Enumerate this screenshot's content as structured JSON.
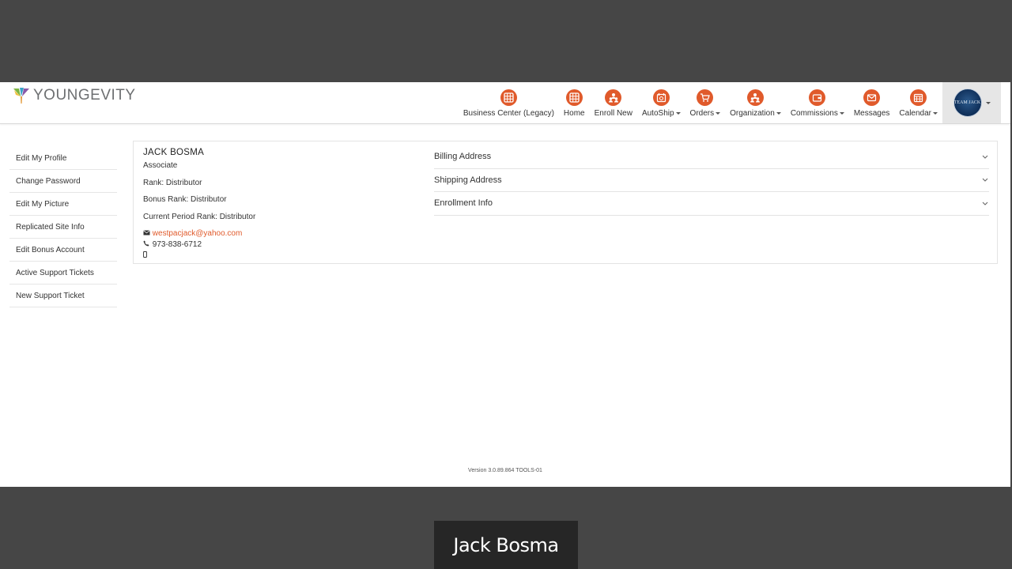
{
  "brand": {
    "name": "YOUNGEVITY",
    "accent": "#e05a2b"
  },
  "nav": [
    {
      "key": "business-center",
      "label": "Business Center (Legacy)",
      "icon": "grid-icon",
      "dropdown": false
    },
    {
      "key": "home",
      "label": "Home",
      "icon": "grid-icon",
      "dropdown": false
    },
    {
      "key": "enroll-new",
      "label": "Enroll New",
      "icon": "people-icon",
      "dropdown": false
    },
    {
      "key": "autoship",
      "label": "AutoShip",
      "icon": "autoship-icon",
      "dropdown": true
    },
    {
      "key": "orders",
      "label": "Orders",
      "icon": "cart-icon",
      "dropdown": true
    },
    {
      "key": "organization",
      "label": "Organization",
      "icon": "org-icon",
      "dropdown": true
    },
    {
      "key": "commissions",
      "label": "Commissions",
      "icon": "wallet-icon",
      "dropdown": true
    },
    {
      "key": "messages",
      "label": "Messages",
      "icon": "envelope-icon",
      "dropdown": false
    },
    {
      "key": "calendar",
      "label": "Calendar",
      "icon": "calendar-icon",
      "dropdown": true
    }
  ],
  "profile_avatar_text": "TEAM JACK",
  "sidebar": {
    "items": [
      "Edit My Profile",
      "Change Password",
      "Edit My Picture",
      "Replicated Site Info",
      "Edit Bonus Account",
      "Active Support Tickets",
      "New Support Ticket"
    ]
  },
  "profile": {
    "name": "JACK BOSMA",
    "title": "Associate",
    "rank": "Rank: Distributor",
    "bonus_rank": "Bonus Rank: Distributor",
    "current_period_rank": "Current Period Rank: Distributor",
    "email": "westpacjack@yahoo.com",
    "phone": "973-838-6712"
  },
  "accordion": [
    "Billing Address",
    "Shipping Address",
    "Enrollment Info"
  ],
  "version": "Version 3.0.89.864 TOOLS-01",
  "caption": "Jack Bosma"
}
